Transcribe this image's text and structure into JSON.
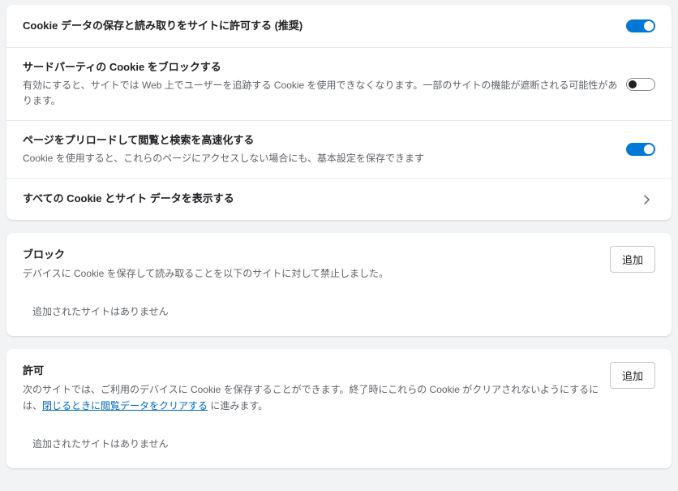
{
  "settings": {
    "allowCookies": {
      "title": "Cookie データの保存と読み取りをサイトに許可する (推奨)",
      "enabled": true
    },
    "blockThirdParty": {
      "title": "サードパーティの Cookie をブロックする",
      "sub": "有効にすると、サイトでは Web 上でユーザーを追跡する Cookie を使用できなくなります。一部のサイトの機能が遮断される可能性があります。",
      "enabled": false
    },
    "preload": {
      "title": "ページをプリロードして閲覧と検索を高速化する",
      "sub": "Cookie を使用すると、これらのページにアクセスしない場合にも、基本設定を保存できます",
      "enabled": true
    },
    "viewAll": {
      "title": "すべての Cookie とサイト データを表示する"
    }
  },
  "blockSection": {
    "title": "ブロック",
    "sub": "デバイスに Cookie を保存して読み取ることを以下のサイトに対して禁止しました。",
    "add": "追加",
    "empty": "追加されたサイトはありません"
  },
  "allowSection": {
    "title": "許可",
    "subA": "次のサイトでは、ご利用のデバイスに Cookie を保存することができます。終了時にこれらの Cookie がクリアされないようにするには、",
    "link": "閉じるときに閲覧データをクリアする",
    "subB": " に進みます。",
    "add": "追加",
    "empty": "追加されたサイトはありません"
  }
}
